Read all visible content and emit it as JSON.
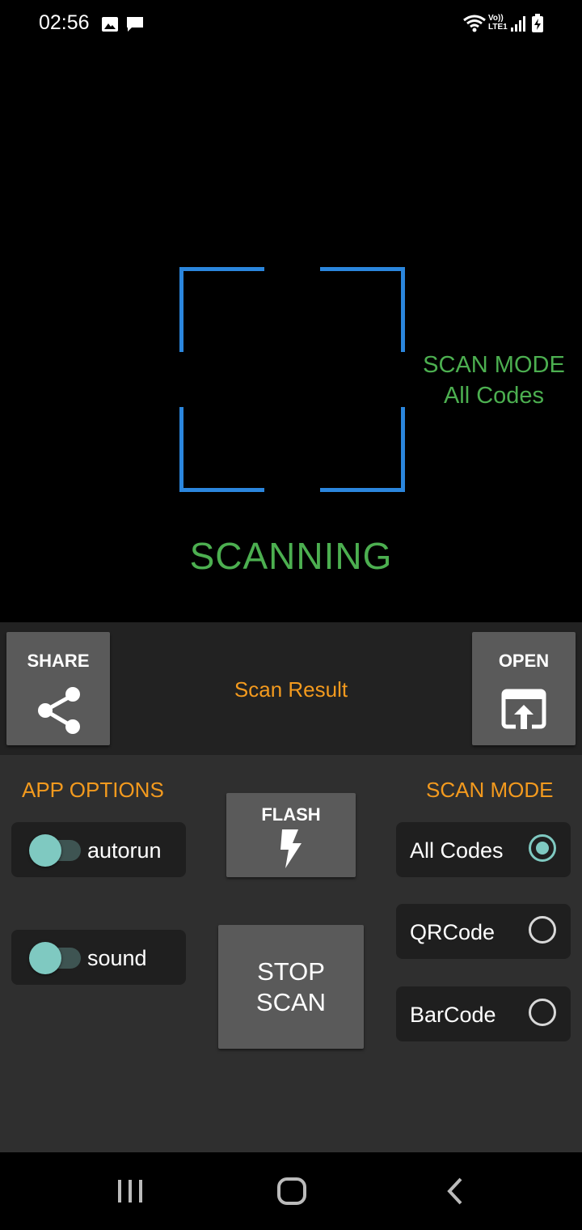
{
  "status_bar": {
    "time": "02:56",
    "left_icons": [
      "image-icon",
      "message-icon"
    ],
    "right_icons": [
      "wifi-icon",
      "volte-lte-icon",
      "signal-icon",
      "battery-charging-icon"
    ],
    "network_label_top": "Vo))",
    "network_label_bottom": "LTE1"
  },
  "scanner": {
    "mode_title": "SCAN MODE",
    "mode_value": "All Codes",
    "status": "SCANNING",
    "frame_color": "#2b86dd"
  },
  "result_panel": {
    "share_label": "SHARE",
    "share_icon": "share-icon",
    "result_text": "Scan Result",
    "open_label": "OPEN",
    "open_icon": "open-in-app-icon"
  },
  "app_options": {
    "title": "APP OPTIONS",
    "toggles": [
      {
        "label": "autorun",
        "on": false
      },
      {
        "label": "sound",
        "on": false
      }
    ]
  },
  "controls": {
    "flash_label": "FLASH",
    "flash_icon": "flash-icon",
    "stop_scan_label": "STOP SCAN"
  },
  "scan_mode": {
    "title": "SCAN MODE",
    "options": [
      {
        "label": "All Codes",
        "selected": true
      },
      {
        "label": "QRCode",
        "selected": false
      },
      {
        "label": "BarCode",
        "selected": false
      }
    ]
  },
  "colors": {
    "accent_orange": "#f39a1e",
    "status_green": "#4caf50",
    "toggle_teal": "#7fc9c1"
  },
  "nav_bar": {
    "buttons": [
      "recents-icon",
      "home-icon",
      "back-icon"
    ]
  }
}
